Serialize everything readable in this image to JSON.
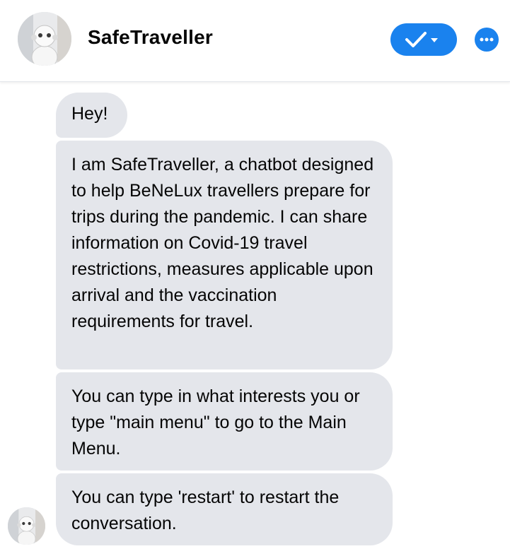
{
  "header": {
    "title": "SafeTraveller",
    "avatar_icon": "robot-avatar-icon",
    "status_button_icon": "check-dropdown-icon",
    "more_button_icon": "more-options-icon",
    "accent_color": "#1a82ee"
  },
  "messages": [
    {
      "text": "Hey!"
    },
    {
      "text": "I am SafeTraveller, a chatbot designed to help BeNeLux travellers prepare for trips during the pandemic. I can share information on Covid-19 travel restrictions, measures applicable upon arrival and the vaccination requirements for travel."
    },
    {
      "text": "You can type in what interests you or type \"main menu\" to go to the Main Menu."
    },
    {
      "text": "You can type 'restart' to restart the conversation."
    }
  ]
}
